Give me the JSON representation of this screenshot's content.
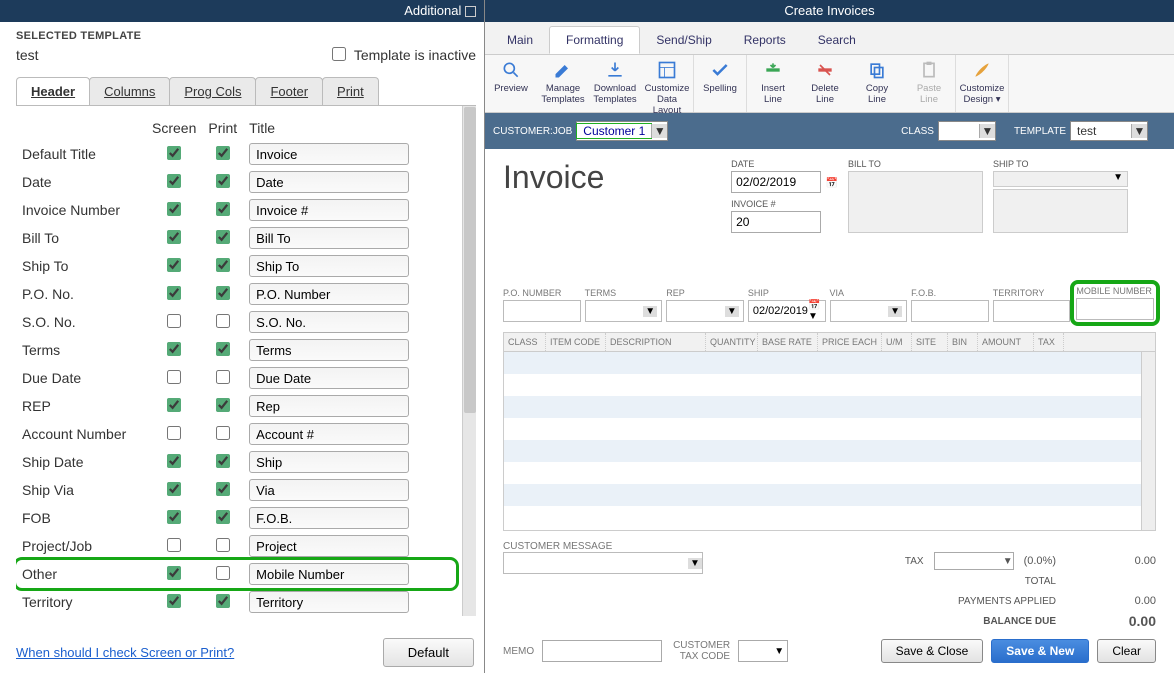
{
  "left": {
    "title": "Additional",
    "selected_template_label": "SELECTED TEMPLATE",
    "template_name": "test",
    "inactive_label": "Template is inactive",
    "tabs": [
      "Header",
      "Columns",
      "Prog Cols",
      "Footer",
      "Print"
    ],
    "col_headers": {
      "screen": "Screen",
      "print": "Print",
      "title": "Title"
    },
    "fields": [
      {
        "label": "Default Title",
        "screen": true,
        "print": true,
        "title": "Invoice"
      },
      {
        "label": "Date",
        "screen": true,
        "print": true,
        "title": "Date"
      },
      {
        "label": "Invoice Number",
        "screen": true,
        "print": true,
        "title": "Invoice #"
      },
      {
        "label": "Bill To",
        "screen": true,
        "print": true,
        "title": "Bill To"
      },
      {
        "label": "Ship To",
        "screen": true,
        "print": true,
        "title": "Ship To"
      },
      {
        "label": "P.O. No.",
        "screen": true,
        "print": true,
        "title": "P.O. Number"
      },
      {
        "label": "S.O. No.",
        "screen": false,
        "print": false,
        "title": "S.O. No."
      },
      {
        "label": "Terms",
        "screen": true,
        "print": true,
        "title": "Terms"
      },
      {
        "label": "Due Date",
        "screen": false,
        "print": false,
        "title": "Due Date"
      },
      {
        "label": "REP",
        "screen": true,
        "print": true,
        "title": "Rep"
      },
      {
        "label": "Account Number",
        "screen": false,
        "print": false,
        "title": "Account #"
      },
      {
        "label": "Ship Date",
        "screen": true,
        "print": true,
        "title": "Ship"
      },
      {
        "label": "Ship Via",
        "screen": true,
        "print": true,
        "title": "Via"
      },
      {
        "label": "FOB",
        "screen": true,
        "print": true,
        "title": "F.O.B."
      },
      {
        "label": "Project/Job",
        "screen": false,
        "print": false,
        "title": "Project"
      },
      {
        "label": "Other",
        "screen": true,
        "print": false,
        "title": "Mobile Number",
        "highlight": true
      },
      {
        "label": "Territory",
        "screen": true,
        "print": true,
        "title": "Territory"
      }
    ],
    "help_link": "When should I check Screen or Print?",
    "default_btn": "Default"
  },
  "right": {
    "title": "Create Invoices",
    "ribbon_tabs": [
      "Main",
      "Formatting",
      "Send/Ship",
      "Reports",
      "Search"
    ],
    "ribbon_buttons": [
      {
        "label": "Preview",
        "icon": "magnify"
      },
      {
        "label": "Manage Templates",
        "icon": "pencil"
      },
      {
        "label": "Download Templates",
        "icon": "download"
      },
      {
        "label": "Customize Data Layout",
        "icon": "layout"
      },
      {
        "label": "Spelling",
        "icon": "check"
      },
      {
        "label": "Insert Line",
        "icon": "insert"
      },
      {
        "label": "Delete Line",
        "icon": "delete"
      },
      {
        "label": "Copy Line",
        "icon": "copy"
      },
      {
        "label": "Paste Line",
        "icon": "paste",
        "disabled": true
      },
      {
        "label": "Customize Design ▾",
        "icon": "brush"
      }
    ],
    "subheader": {
      "customer_job_label": "CUSTOMER:JOB",
      "customer_job_value": "Customer 1",
      "class_label": "CLASS",
      "class_value": "",
      "template_label": "TEMPLATE",
      "template_value": "test"
    },
    "invoice": {
      "heading": "Invoice",
      "date_label": "DATE",
      "date_value": "02/02/2019",
      "invoice_no_label": "INVOICE #",
      "invoice_no_value": "20",
      "bill_to_label": "BILL TO",
      "ship_to_label": "SHIP TO",
      "midcols": [
        {
          "label": "P.O. NUMBER",
          "value": "",
          "type": "input"
        },
        {
          "label": "TERMS",
          "value": "",
          "type": "select"
        },
        {
          "label": "REP",
          "value": "",
          "type": "select"
        },
        {
          "label": "SHIP",
          "value": "02/02/2019",
          "type": "date"
        },
        {
          "label": "VIA",
          "value": "",
          "type": "select"
        },
        {
          "label": "F.O.B.",
          "value": "",
          "type": "input"
        },
        {
          "label": "TERRITORY",
          "value": "",
          "type": "input"
        },
        {
          "label": "MOBILE NUMBER",
          "value": "",
          "type": "input",
          "highlight": true
        }
      ],
      "grid_cols": [
        "CLASS",
        "ITEM CODE",
        "DESCRIPTION",
        "QUANTITY",
        "BASE RATE",
        "PRICE EACH",
        "U/M",
        "SITE",
        "BIN",
        "AMOUNT",
        "TAX"
      ],
      "tax_label": "TAX",
      "tax_pct": "(0.0%)",
      "tax_amount": "0.00",
      "total_label": "TOTAL",
      "payments_label": "PAYMENTS APPLIED",
      "payments_value": "0.00",
      "balance_label": "BALANCE DUE",
      "balance_value": "0.00",
      "customer_message_label": "CUSTOMER MESSAGE",
      "memo_label": "MEMO",
      "customer_tax_label": "CUSTOMER TAX CODE",
      "buttons": {
        "save_close": "Save & Close",
        "save_new": "Save & New",
        "clear": "Clear"
      }
    }
  }
}
